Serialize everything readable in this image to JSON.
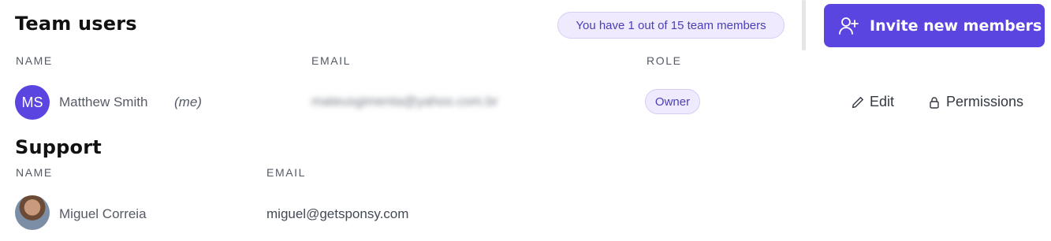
{
  "team": {
    "title": "Team users",
    "member_count_text": "You have 1 out of 15 team members",
    "invite_label": "Invite new members",
    "columns": {
      "name": "NAME",
      "email": "EMAIL",
      "role": "ROLE"
    },
    "rows": [
      {
        "initials": "MS",
        "name": "Matthew Smith",
        "me": "(me)",
        "email": "mateusgimenta@yahoo.com.br",
        "role": "Owner",
        "edit_label": "Edit",
        "permissions_label": "Permissions"
      }
    ]
  },
  "support": {
    "title": "Support",
    "columns": {
      "name": "NAME",
      "email": "EMAIL"
    },
    "rows": [
      {
        "name": "Miguel Correia",
        "email": "miguel@getsponsy.com"
      }
    ]
  },
  "colors": {
    "accent": "#5b45e0",
    "pill_bg": "#efeafd",
    "pill_text": "#4b3fb8"
  },
  "icons": {
    "invite": "user-plus-icon",
    "edit": "pencil-icon",
    "permissions": "lock-icon"
  }
}
